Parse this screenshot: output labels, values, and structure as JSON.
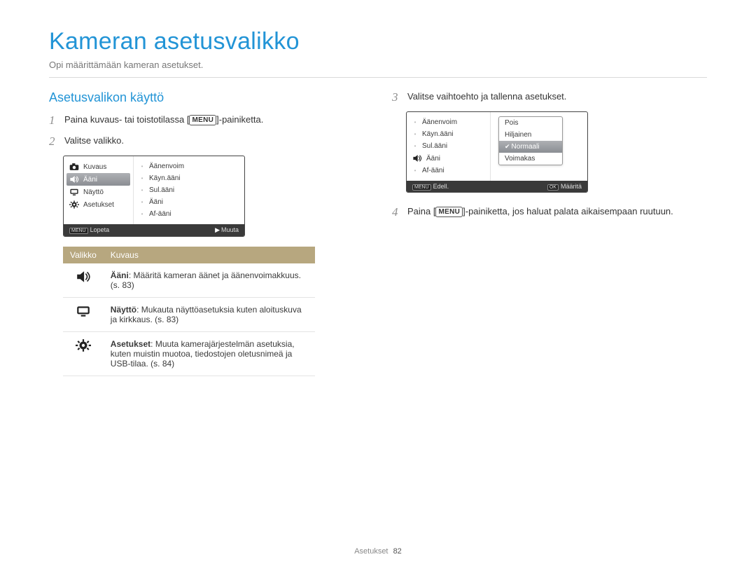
{
  "title": "Kameran asetusvalikko",
  "subtitle": "Opi määrittämään kameran asetukset.",
  "section": "Asetusvalikon käyttö",
  "menu_word": "MENU",
  "steps": {
    "s1a": "Paina kuvaus- tai toistotilassa [",
    "s1b": "]-painiketta.",
    "s2": "Valitse valikko.",
    "s3": "Valitse vaihtoehto ja tallenna asetukset.",
    "s4a": "Paina [",
    "s4b": "]-painiketta, jos haluat palata aikaisempaan ruutuun."
  },
  "nums": {
    "n1": "1",
    "n2": "2",
    "n3": "3",
    "n4": "4"
  },
  "lcd1": {
    "left": {
      "kuvaus": "Kuvaus",
      "aani": "Ääni",
      "naytto": "Näyttö",
      "asetukset": "Asetukset"
    },
    "right": {
      "aanenvoim": "Äänenvoim",
      "kayn": "Käyn.ääni",
      "sul": "Sul.ääni",
      "aani": "Ääni",
      "af": "Af-ääni"
    },
    "foot_left_btn": "MENU",
    "foot_left": "Lopeta",
    "foot_right_arrow": "▶",
    "foot_right": "Muuta"
  },
  "lcd2": {
    "left": {
      "head": "Äänenvoim",
      "kayn": "Käyn.ääni",
      "sul": "Sul.ääni",
      "aani": "Ääni",
      "af": "Af-ääni"
    },
    "popup": {
      "pois": "Pois",
      "hilj": "Hiljainen",
      "norm": "Normaali",
      "voim": "Voimakas"
    },
    "foot_left_btn": "MENU",
    "foot_left": "Edell.",
    "foot_right_btn": "OK",
    "foot_right": "Määritä"
  },
  "table": {
    "h1": "Valikko",
    "h2": "Kuvaus",
    "r1b": "Ääni",
    "r1": ": Määritä kameran äänet ja äänenvoimakkuus. (s. 83)",
    "r2b": "Näyttö",
    "r2": ": Mukauta näyttöasetuksia kuten aloituskuva ja kirkkaus. (s. 83)",
    "r3b": "Asetukset",
    "r3": ": Muuta kamerajärjestelmän asetuksia, kuten muistin muotoa, tiedostojen oletusnimeä ja USB-tilaa. (s. 84)"
  },
  "footer_label": "Asetukset",
  "footer_page": "82"
}
